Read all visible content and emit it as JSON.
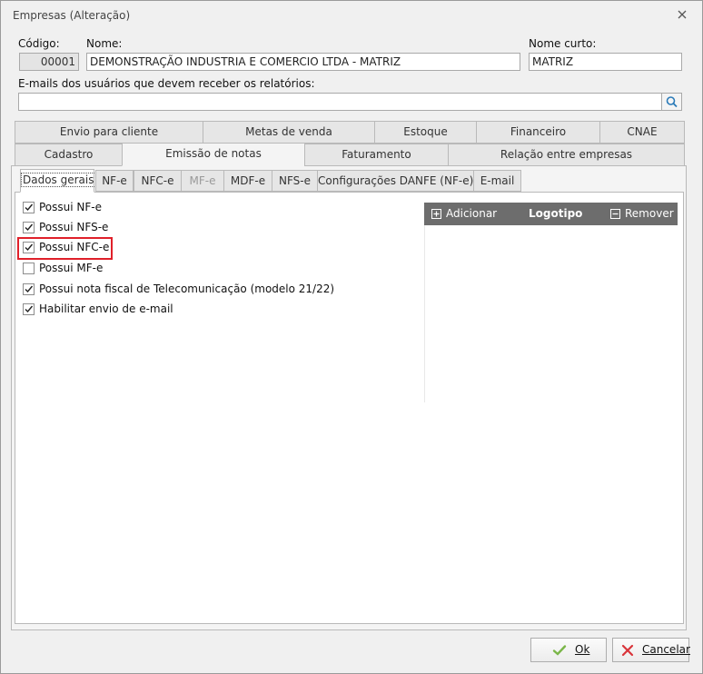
{
  "window": {
    "title": "Empresas (Alteração)"
  },
  "form": {
    "codigo_label": "Código:",
    "codigo_value": "00001",
    "nome_label": "Nome:",
    "nome_value": "DEMONSTRAÇÃO INDUSTRIA E COMERCIO LTDA - MATRIZ",
    "nome_curto_label": "Nome curto:",
    "nome_curto_value": "MATRIZ",
    "emails_label": "E-mails dos usuários que devem receber os relatórios:",
    "emails_value": ""
  },
  "tabs_row1": [
    "Envio para cliente",
    "Metas de venda",
    "Estoque",
    "Financeiro",
    "CNAE"
  ],
  "tabs_row2": [
    "Cadastro",
    "Emissão de notas",
    "Faturamento",
    "Relação entre empresas"
  ],
  "active_tab": "Emissão de notas",
  "subtabs": [
    "Dados gerais",
    "NF-e",
    "NFC-e",
    "MF-e",
    "MDF-e",
    "NFS-e",
    "Configurações DANFE (NF-e)",
    "E-mail"
  ],
  "active_subtab": "Dados gerais",
  "disabled_subtab": "MF-e",
  "checkboxes": [
    {
      "label": "Possui NF-e",
      "checked": true
    },
    {
      "label": "Possui NFS-e",
      "checked": true
    },
    {
      "label": "Possui NFC-e",
      "checked": true
    },
    {
      "label": "Possui MF-e",
      "checked": false
    },
    {
      "label": "Possui nota fiscal de Telecomunicação (modelo 21/22)",
      "checked": true
    },
    {
      "label": "Habilitar envio de e-mail",
      "checked": true
    }
  ],
  "logo": {
    "add_label": "Adicionar",
    "title": "Logotipo",
    "remove_label": "Remover"
  },
  "buttons": {
    "ok_label": "Ok",
    "cancel_label": "Cancelar"
  },
  "colors": {
    "highlight": "#e0202a",
    "ok_check": "#7ab648",
    "cancel_x": "#d9343a",
    "logo_header": "#6d6d6d"
  }
}
